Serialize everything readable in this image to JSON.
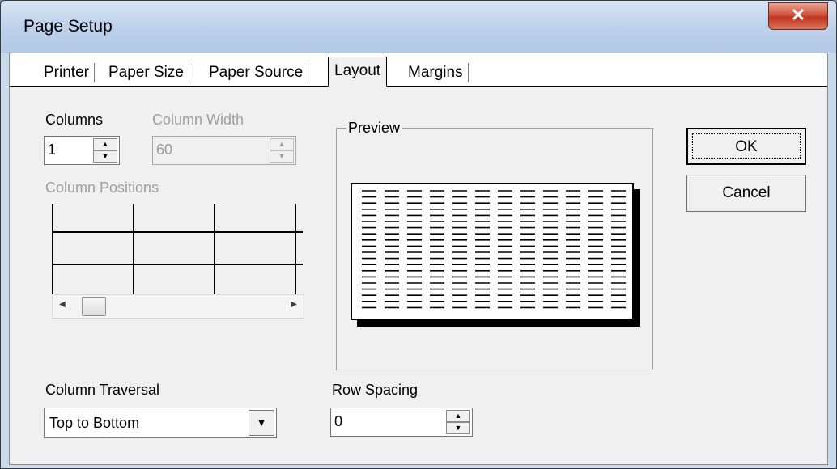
{
  "window": {
    "title": "Page Setup"
  },
  "tabs": [
    {
      "label": "Printer"
    },
    {
      "label": "Paper Size"
    },
    {
      "label": "Paper Source"
    },
    {
      "label": "Layout"
    },
    {
      "label": "Margins"
    }
  ],
  "active_tab": "Layout",
  "columns": {
    "label": "Columns",
    "value": "1"
  },
  "column_width": {
    "label": "Column Width",
    "value": "60"
  },
  "column_positions": {
    "label": "Column Positions"
  },
  "preview": {
    "label": "Preview"
  },
  "buttons": {
    "ok": "OK",
    "cancel": "Cancel"
  },
  "column_traversal": {
    "label": "Column Traversal",
    "value": "Top to Bottom"
  },
  "row_spacing": {
    "label": "Row Spacing",
    "value": "0"
  },
  "icons": {
    "close": "close-icon",
    "spin_up": "arrow-up-icon",
    "spin_down": "arrow-down-icon",
    "dropdown": "chevron-down-icon"
  },
  "colors": {
    "title_bar": "#bcd0ea",
    "close_button": "#c9422c",
    "dialog_bg": "#f0f0f0"
  }
}
